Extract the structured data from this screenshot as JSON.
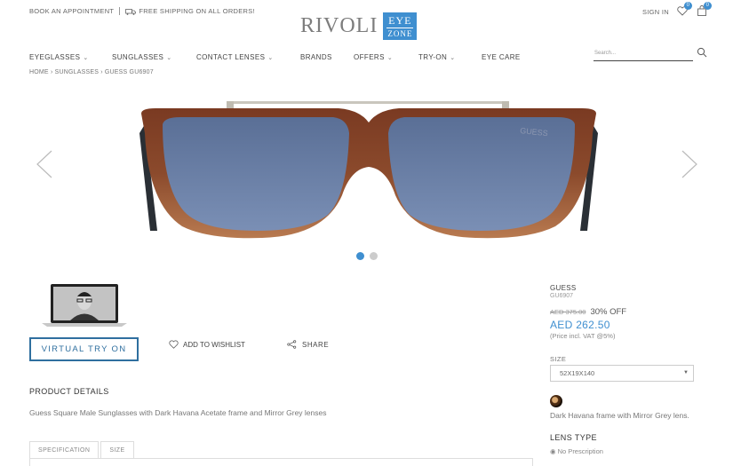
{
  "topbar": {
    "appointment": "BOOK AN APPOINTMENT",
    "shipping": "FREE SHIPPING ON ALL ORDERS!",
    "sign_in": "SIGN IN",
    "wishlist_count": "0",
    "cart_count": "0"
  },
  "logo": {
    "word": "RIVOLI",
    "badge_top": "EYE",
    "badge_bottom": "ZONE",
    "badge_color": "#3f8fd0"
  },
  "nav": {
    "items": [
      {
        "label": "EYEGLASSES",
        "dropdown": true
      },
      {
        "label": "SUNGLASSES",
        "dropdown": true
      },
      {
        "label": "CONTACT LENSES",
        "dropdown": true
      },
      {
        "label": "BRANDS",
        "dropdown": false
      },
      {
        "label": "OFFERS",
        "dropdown": true
      },
      {
        "label": "TRY-ON",
        "dropdown": true
      },
      {
        "label": "EYE CARE",
        "dropdown": false
      }
    ],
    "search_placeholder": "Search..."
  },
  "breadcrumb": "HOME › SUNGLASSES › GUESS GU6907",
  "gallery": {
    "frame_logo": "GUESS",
    "slide_count": 2,
    "active_slide": 1
  },
  "actions": {
    "virtual_try_on": "VIRTUAL TRY ON",
    "add_to_wishlist": "ADD TO WISHLIST",
    "share": "SHARE"
  },
  "product": {
    "details_title": "PRODUCT DETAILS",
    "description": "Guess Square Male Sunglasses with Dark Havana Acetate frame and Mirror Grey lenses",
    "tabs": [
      "SPECIFICATION",
      "SIZE"
    ],
    "brand": "GUESS",
    "model": "GU6907",
    "old_price": "AED 375.00",
    "discount": "30% OFF",
    "price": "AED 262.50",
    "vat_note": "(Price incl. VAT @5%)",
    "size_label": "SIZE",
    "size_value": "52X19X140",
    "color_description": "Dark Havana frame with Mirror Grey lens.",
    "lens_type_label": "LENS TYPE",
    "lens_option": "No Prescription"
  }
}
